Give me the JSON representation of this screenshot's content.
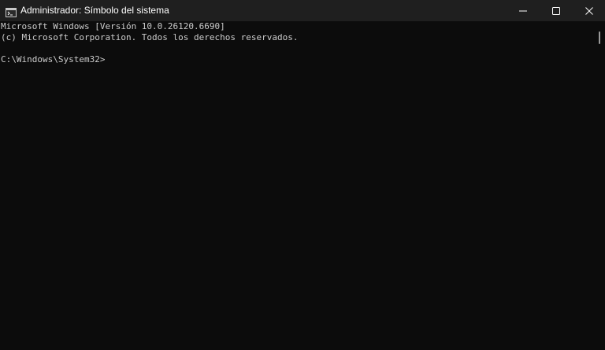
{
  "window": {
    "title": "Administrador: Símbolo del sistema"
  },
  "titlebar_icons": {
    "app": "cmd-icon",
    "minimize": "minimize-icon",
    "maximize": "maximize-icon",
    "close": "close-icon"
  },
  "console": {
    "lines": [
      "Microsoft Windows [Versión 10.0.26120.6690]",
      "(c) Microsoft Corporation. Todos los derechos reservados.",
      "",
      "C:\\Windows\\System32>"
    ]
  },
  "colors": {
    "background": "#0c0c0c",
    "titlebar": "#1f1f1f",
    "text": "#cccccc"
  }
}
